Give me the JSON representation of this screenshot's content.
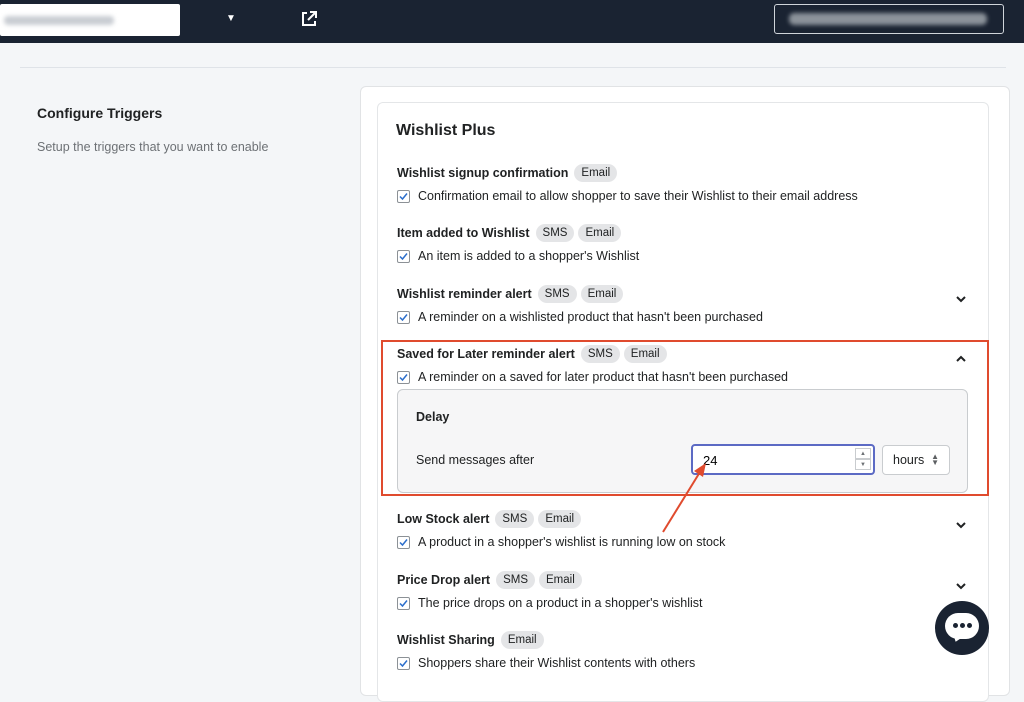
{
  "page": {
    "section_title": "Configure Triggers",
    "section_description": "Setup the triggers that you want to enable"
  },
  "card": {
    "title": "Wishlist Plus"
  },
  "triggers": [
    {
      "name": "Wishlist signup confirmation",
      "badges": [
        "Email"
      ],
      "description": "Confirmation email to allow shopper to save their Wishlist to their email address",
      "checked": true
    },
    {
      "name": "Item added to Wishlist",
      "badges": [
        "SMS",
        "Email"
      ],
      "description": "An item is added to a shopper's Wishlist",
      "checked": true
    },
    {
      "name": "Wishlist reminder alert",
      "badges": [
        "SMS",
        "Email"
      ],
      "description": "A reminder on a wishlisted product that hasn't been purchased",
      "checked": true
    },
    {
      "name": "Saved for Later reminder alert",
      "badges": [
        "SMS",
        "Email"
      ],
      "description": "A reminder on a saved for later product that hasn't been purchased",
      "checked": true
    },
    {
      "name": "Low Stock alert",
      "badges": [
        "SMS",
        "Email"
      ],
      "description": "A product in a shopper's wishlist is running low on stock",
      "checked": true
    },
    {
      "name": "Price Drop alert",
      "badges": [
        "SMS",
        "Email"
      ],
      "description": "The price drops on a product in a shopper's wishlist",
      "checked": true
    },
    {
      "name": "Wishlist Sharing",
      "badges": [
        "Email"
      ],
      "description": "Shoppers share their Wishlist contents with others",
      "checked": true
    }
  ],
  "delay": {
    "title": "Delay",
    "label": "Send messages after",
    "value": "24",
    "unit": "hours"
  },
  "colors": {
    "topbar": "#1a2332",
    "highlight": "#e04b2e",
    "focus": "#5c6ac4"
  }
}
